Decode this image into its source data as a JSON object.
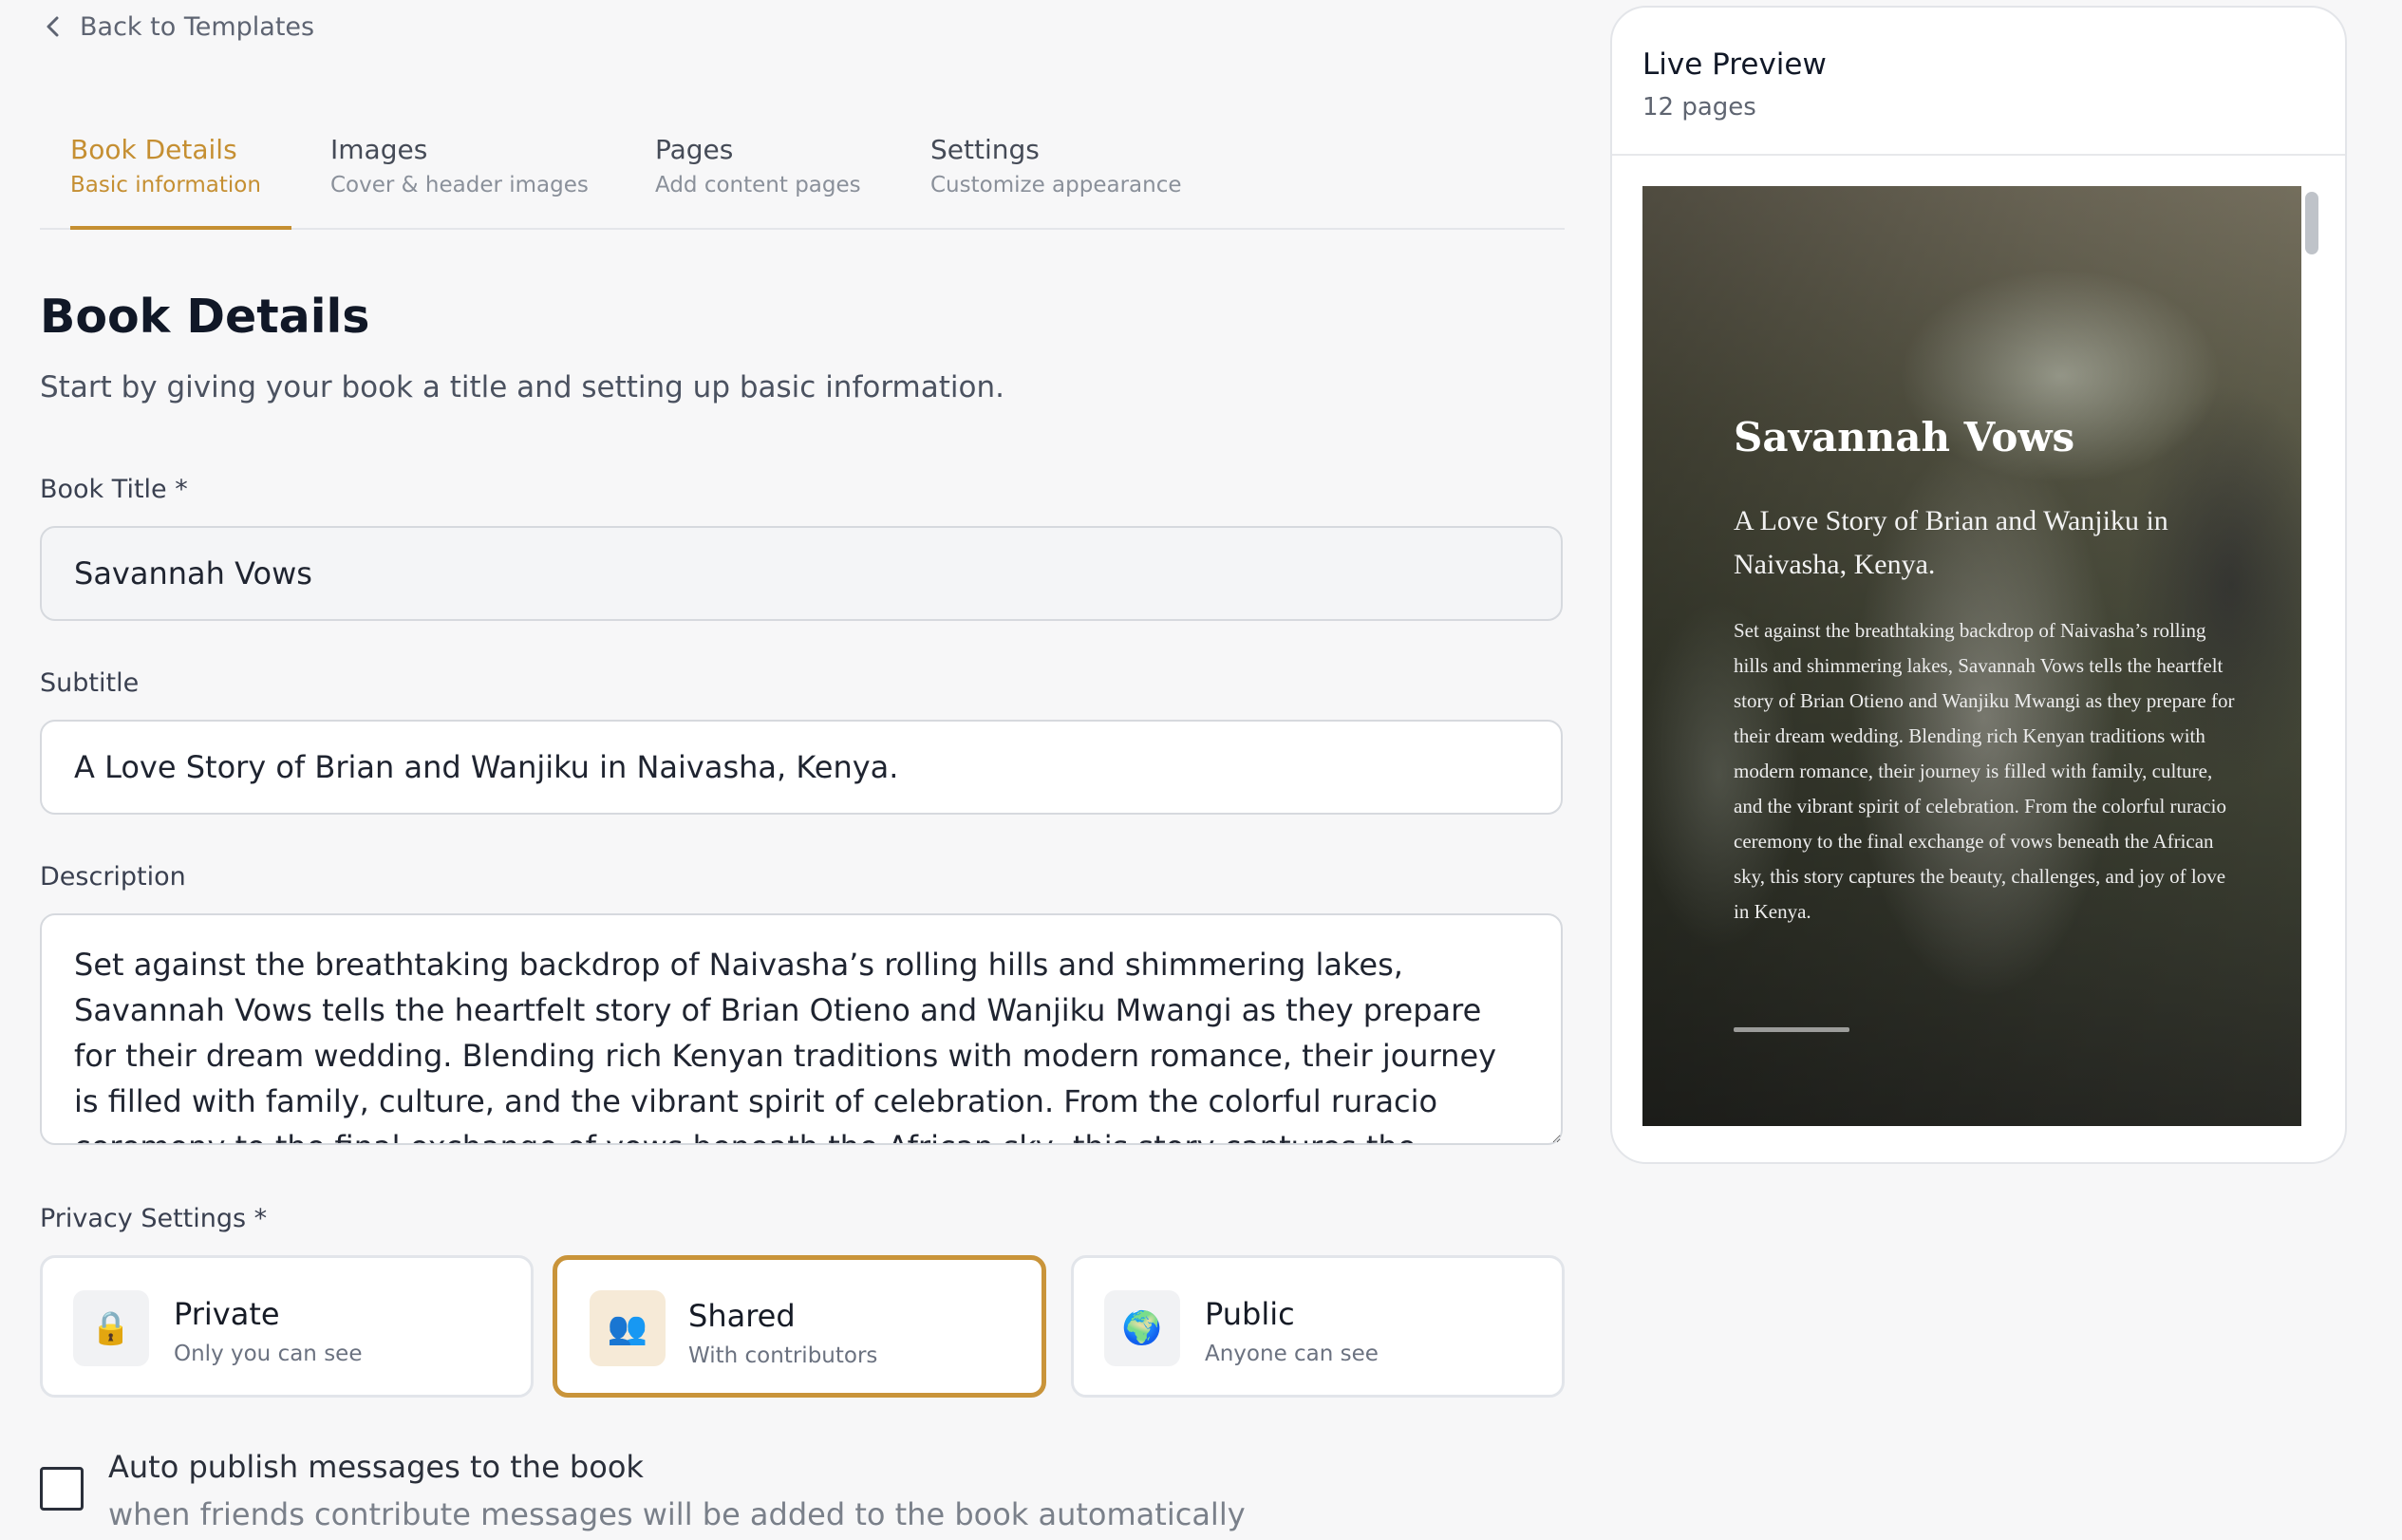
{
  "nav": {
    "back_label": "Back to Templates"
  },
  "tabs": [
    {
      "label": "Book Details",
      "sub": "Basic information",
      "active": true
    },
    {
      "label": "Images",
      "sub": "Cover & header images"
    },
    {
      "label": "Pages",
      "sub": "Add content pages"
    },
    {
      "label": "Settings",
      "sub": "Customize appearance"
    }
  ],
  "main": {
    "title": "Book Details",
    "subtitle": "Start by giving your book a title and setting up basic information.",
    "book_title_label": "Book Title *",
    "book_title_value": "Savannah Vows",
    "subtitle_label": "Subtitle",
    "subtitle_value": "A Love Story of Brian and Wanjiku in Naivasha, Kenya.",
    "description_label": "Description",
    "description_value": "Set against the breathtaking backdrop of Naivasha’s rolling hills and shimmering lakes, Savannah Vows tells the heartfelt story of Brian Otieno and Wanjiku Mwangi as they prepare for their dream wedding. Blending rich Kenyan traditions with modern romance, their journey is filled with family, culture, and the vibrant spirit of celebration. From the colorful ruracio ceremony to the final exchange of vows beneath the African sky, this story captures the beauty, challenges, and joy of love in Kenya.",
    "privacy_label": "Privacy Settings *",
    "privacy_options": [
      {
        "title": "Private",
        "sub": "Only you can see",
        "icon": "lock-icon",
        "glyph": "🔒",
        "selected": false
      },
      {
        "title": "Shared",
        "sub": "With contributors",
        "icon": "people-icon",
        "glyph": "👥",
        "selected": true
      },
      {
        "title": "Public",
        "sub": "Anyone can see",
        "icon": "globe-icon",
        "glyph": "🌍",
        "selected": false
      }
    ],
    "auto_publish_label": "Auto publish messages to the book",
    "auto_publish_sub": "when friends contribute messages will be added to the book automatically",
    "auto_publish_checked": false
  },
  "preview": {
    "title": "Live Preview",
    "pages": "12 pages",
    "book_title": "Savannah Vows",
    "book_subtitle": "A Love Story of Brian and Wanjiku in Naivasha, Kenya.",
    "book_description": "Set against the breathtaking backdrop of Naivasha’s rolling hills and shimmering lakes, Savannah Vows tells the heartfelt story of Brian Otieno and Wanjiku Mwangi as they prepare for their dream wedding. Blending rich Kenyan traditions with modern romance, their journey is filled with family, culture, and the vibrant spirit of celebration. From the colorful ruracio ceremony to the final exchange of vows beneath the African sky, this story captures the beauty, challenges, and joy of love in Kenya."
  },
  "colors": {
    "accent": "#c58f32",
    "selected_border": "#c9943a",
    "text_dark": "#111827"
  }
}
